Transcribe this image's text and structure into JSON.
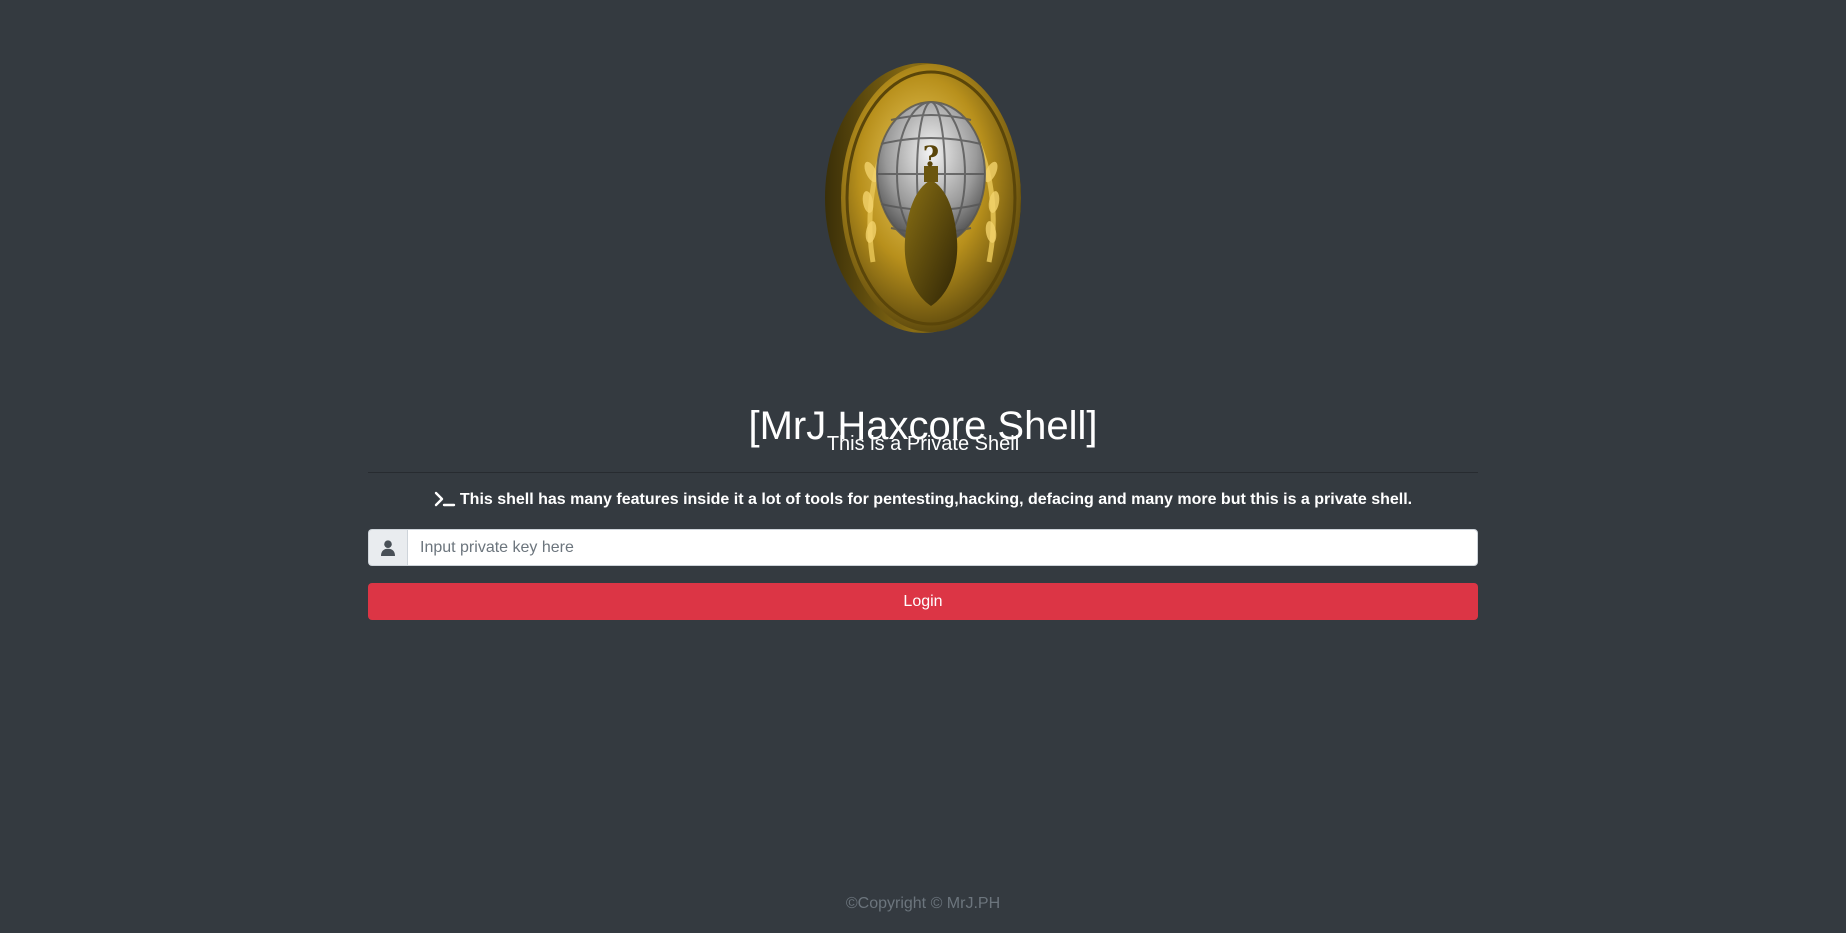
{
  "header": {
    "logo_icon": "anonymous-emblem-coin",
    "title": "[MrJ Haxcore Shell]",
    "subtitle": "This is a Private Shell"
  },
  "description": {
    "icon": "terminal-icon",
    "text": "This shell has many features inside it a lot of tools for pentesting,hacking, defacing and many more but this is a private shell."
  },
  "login_form": {
    "user_icon": "user-icon",
    "key_input_placeholder": "Input private key here",
    "key_input_value": "",
    "login_label": "Login"
  },
  "footer": {
    "copyright": "©Copyright © MrJ.PH"
  },
  "colors": {
    "background": "#343a40",
    "accent_button": "#dc3545",
    "text": "#ffffff",
    "muted_text": "#6c757d",
    "emblem_gold": "#c9a227"
  }
}
